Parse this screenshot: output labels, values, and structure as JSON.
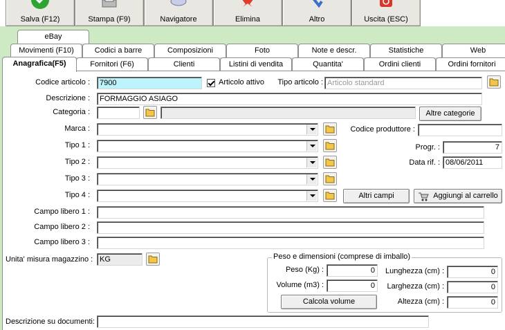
{
  "toolbar": {
    "save": "Salva (F12)",
    "print": "Stampa (F9)",
    "navigator": "Navigatore",
    "delete": "Elimina",
    "other": "Altro",
    "exit": "Uscita (ESC)"
  },
  "tabs": {
    "row1": [
      "eBay"
    ],
    "row2": [
      "Movimenti (F10)",
      "Codici a barre",
      "Composizioni",
      "Foto",
      "Note e descr.",
      "Statistiche",
      "Web"
    ],
    "row3": [
      "Anagrafica(F5)",
      "Fornitori (F6)",
      "Clienti",
      "Listini di vendita",
      "Quantita'",
      "Ordini clienti",
      "Ordini fornitori"
    ],
    "active": "Anagrafica(F5)"
  },
  "form": {
    "codice_label": "Codice articolo :",
    "codice_value": "7900",
    "attivo_label": "Articolo attivo",
    "attivo_checked": true,
    "tipo_articolo_label": "Tipo articolo :",
    "tipo_articolo_value": "Articolo standard",
    "descrizione_label": "Descrizione :",
    "descrizione_value": "FORMAGGIO ASIAGO",
    "categoria_label": "Categoria :",
    "categoria_value": "",
    "altre_categorie": "Altre categorie",
    "marca_label": "Marca :",
    "tipo1_label": "Tipo 1 :",
    "tipo2_label": "Tipo 2 :",
    "tipo3_label": "Tipo 3 :",
    "tipo4_label": "Tipo 4 :",
    "codice_produttore_label": "Codice produttore :",
    "codice_produttore_value": "",
    "progr_label": "Progr. :",
    "progr_value": "7",
    "data_rif_label": "Data rif. :",
    "data_rif_value": "08/06/2011",
    "altri_campi": "Altri campi",
    "aggiungi_carrello": "Aggiungi al carrello",
    "campo1_label": "Campo libero 1 :",
    "campo2_label": "Campo libero 2 :",
    "campo3_label": "Campo libero 3 :",
    "unita_label": "Unita' misura magazzino :",
    "unita_value": "KG",
    "descr_documenti_label": "Descrizione su documenti:",
    "descr_documenti_value": ""
  },
  "peso_dimensioni": {
    "title": "Peso e dimensioni (comprese di imballo)",
    "peso_label": "Peso (Kg) :",
    "peso_value": "0",
    "volume_label": "Volume (m3) :",
    "volume_value": "0",
    "calcola_volume": "Calcola volume",
    "lunghezza_label": "Lunghezza (cm) :",
    "lunghezza_value": "0",
    "larghezza_label": "Larghezza (cm) :",
    "larghezza_value": "0",
    "altezza_label": "Altezza (cm) :",
    "altezza_value": "0"
  },
  "colors": {
    "tab_area_bg": "#cdeac5",
    "highlight_field": "#bdf3fb",
    "save_icon": "#2fa531",
    "delete_icon": "#e23b2c",
    "exit_icon": "#d9362a",
    "folder_icon": "#f2c64a"
  },
  "icons": [
    "check-icon",
    "printer-icon",
    "navigator-icon",
    "delete-x-icon",
    "other-icon",
    "exit-icon",
    "folder-icon",
    "cart-icon",
    "dropdown-arrow-icon"
  ]
}
